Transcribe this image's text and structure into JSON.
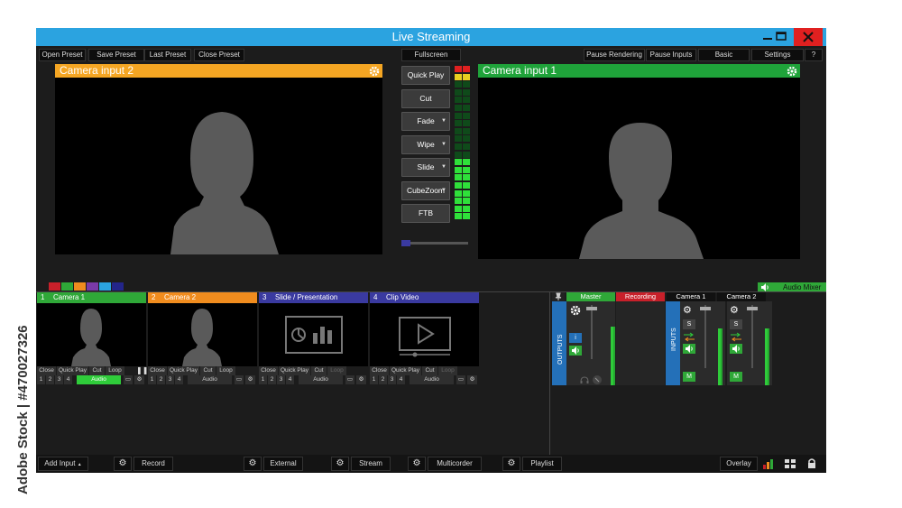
{
  "watermark": "Adobe Stock | #470027326",
  "window": {
    "title": "Live Streaming",
    "minimize_icon": "minimize-icon",
    "maximize_icon": "maximize-icon",
    "close_icon": "close-icon",
    "close_color": "#e02020",
    "title_color": "#2ba3e0"
  },
  "presets": {
    "open": "Open Preset",
    "save": "Save Preset",
    "last": "Last Preset",
    "close": "Close Preset"
  },
  "fullscreen": "Fullscreen",
  "top_right": {
    "pause_rendering": "Pause Rendering",
    "pause_inputs": "Pause Inputs",
    "basic": "Basic",
    "settings": "Settings",
    "help": "?"
  },
  "preview": {
    "title": "Camera input 2",
    "color": "#f5a623"
  },
  "output": {
    "title": "Camera input 1",
    "color": "#1fa33a"
  },
  "transitions": [
    {
      "label": "Quick Play",
      "dropdown": false
    },
    {
      "label": "Cut",
      "dropdown": false
    },
    {
      "label": "Fade",
      "dropdown": true
    },
    {
      "label": "Wipe",
      "dropdown": true
    },
    {
      "label": "Slide",
      "dropdown": true
    },
    {
      "label": "CubeZoom",
      "dropdown": true
    },
    {
      "label": "FTB",
      "dropdown": false
    }
  ],
  "color_tabs": [
    "#c8202a",
    "#2fa838",
    "#f08c1e",
    "#7a3aa8",
    "#2ba3e0",
    "#23258a"
  ],
  "audio_mixer": "Audio Mixer",
  "inputs": [
    {
      "num": "1",
      "name": "Camera 1",
      "color": "#2fa838",
      "controls": [
        "Close",
        "Quick Play",
        "Cut",
        "Loop"
      ],
      "numbers": [
        "1",
        "2",
        "3",
        "4"
      ],
      "audio": "Audio",
      "audio_active": true,
      "thumb": "person-female"
    },
    {
      "num": "2",
      "name": "Camera 2",
      "color": "#f08c1e",
      "controls": [
        "Close",
        "Quick Play",
        "Cut",
        "Loop"
      ],
      "numbers": [
        "1",
        "2",
        "3",
        "4"
      ],
      "audio": "Audio",
      "audio_active": false,
      "thumb": "person-female"
    },
    {
      "num": "3",
      "name": "Slide / Presentation",
      "color": "#3a3aa0",
      "controls": [
        "Close",
        "Quick Play",
        "Cut",
        "Loop"
      ],
      "numbers": [
        "1",
        "2",
        "3",
        "4"
      ],
      "audio": "Audio",
      "audio_active": false,
      "thumb": "presentation-icon"
    },
    {
      "num": "4",
      "name": "Clip Video",
      "color": "#3a3aa0",
      "controls": [
        "Close",
        "Quick Play",
        "Cut",
        "Loop"
      ],
      "numbers": [
        "1",
        "2",
        "3",
        "4"
      ],
      "audio": "Audio",
      "audio_active": false,
      "thumb": "video-play-icon"
    }
  ],
  "mixer": {
    "master": "Master",
    "recording": "Recording",
    "outputs": "OUTPUTS",
    "inputs": "INPUTS",
    "cam1": "Camera 1",
    "cam2": "Camera 2",
    "solo": "S",
    "mute": "M",
    "info": "i"
  },
  "bottom": {
    "add_input": "Add Input",
    "record": "Record",
    "external": "External",
    "stream": "Stream",
    "multicorder": "Multicorder",
    "playlist": "Playlist",
    "overlay": "Overlay"
  }
}
